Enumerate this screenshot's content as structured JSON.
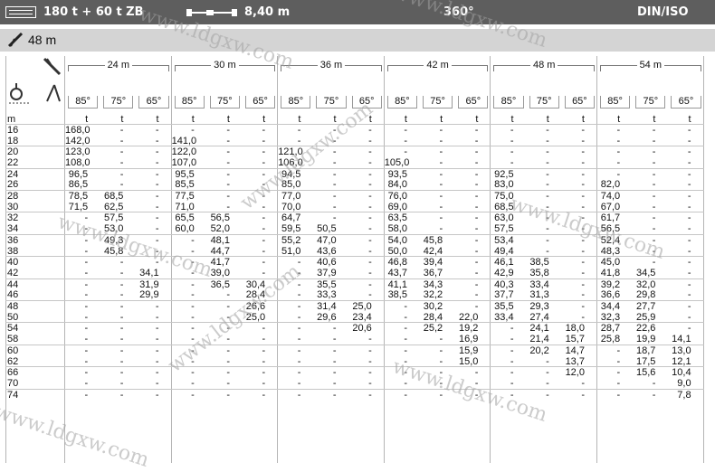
{
  "header": {
    "config": "180 t + 60 t ZB",
    "boom_length": "8,40 m",
    "slew": "360°",
    "standard": "DIN/ISO"
  },
  "subheader": {
    "jib_length": "48 m"
  },
  "table": {
    "luffing_lengths": [
      "24 m",
      "30 m",
      "36 m",
      "42 m",
      "48 m",
      "54 m"
    ],
    "angles": [
      "85°",
      "75°",
      "65°",
      "85°",
      "75°",
      "65°",
      "85°",
      "75°",
      "65°",
      "85°",
      "75°",
      "65°",
      "85°",
      "75°",
      "65°",
      "85°",
      "75°",
      "65°"
    ],
    "unit_row": [
      "m",
      "t",
      "t",
      "t",
      "t",
      "t",
      "t",
      "t",
      "t",
      "t",
      "t",
      "t",
      "t",
      "t",
      "t",
      "t",
      "t",
      "t",
      "t"
    ],
    "rows": [
      [
        "16",
        "168,0",
        "-",
        "-",
        "-",
        "-",
        "-",
        "-",
        "-",
        "-",
        "-",
        "-",
        "-",
        "-",
        "-",
        "-",
        "-",
        "-",
        "-"
      ],
      [
        "18",
        "142,0",
        "-",
        "-",
        "141,0",
        "-",
        "-",
        "-",
        "-",
        "-",
        "-",
        "-",
        "-",
        "-",
        "-",
        "-",
        "-",
        "-",
        "-"
      ],
      [
        "20",
        "123,0",
        "-",
        "-",
        "122,0",
        "-",
        "-",
        "121,0",
        "-",
        "-",
        "-",
        "-",
        "-",
        "-",
        "-",
        "-",
        "-",
        "-",
        "-"
      ],
      [
        "22",
        "108,0",
        "-",
        "-",
        "107,0",
        "-",
        "-",
        "106,0",
        "-",
        "-",
        "105,0",
        "-",
        "-",
        "-",
        "-",
        "-",
        "-",
        "-",
        "-"
      ],
      [
        "24",
        "96,5",
        "-",
        "-",
        "95,5",
        "-",
        "-",
        "94,5",
        "-",
        "-",
        "93,5",
        "-",
        "-",
        "92,5",
        "-",
        "-",
        "-",
        "-",
        "-"
      ],
      [
        "26",
        "86,5",
        "-",
        "-",
        "85,5",
        "-",
        "-",
        "85,0",
        "-",
        "-",
        "84,0",
        "-",
        "-",
        "83,0",
        "-",
        "-",
        "82,0",
        "-",
        "-"
      ],
      [
        "28",
        "78,5",
        "68,5",
        "-",
        "77,5",
        "-",
        "-",
        "77,0",
        "-",
        "-",
        "76,0",
        "-",
        "-",
        "75,0",
        "-",
        "-",
        "74,0",
        "-",
        "-"
      ],
      [
        "30",
        "71,5",
        "62,5",
        "-",
        "71,0",
        "-",
        "-",
        "70,0",
        "-",
        "-",
        "69,0",
        "-",
        "-",
        "68,5",
        "-",
        "-",
        "67,0",
        "-",
        "-"
      ],
      [
        "32",
        "-",
        "57,5",
        "-",
        "65,5",
        "56,5",
        "-",
        "64,7",
        "-",
        "-",
        "63,5",
        "-",
        "-",
        "63,0",
        "-",
        "-",
        "61,7",
        "-",
        "-"
      ],
      [
        "34",
        "-",
        "53,0",
        "-",
        "60,0",
        "52,0",
        "-",
        "59,5",
        "50,5",
        "-",
        "58,0",
        "-",
        "-",
        "57,5",
        "-",
        "-",
        "56,5",
        "-",
        "-"
      ],
      [
        "36",
        "-",
        "49,3",
        "-",
        "-",
        "48,1",
        "-",
        "55,2",
        "47,0",
        "-",
        "54,0",
        "45,8",
        "-",
        "53,4",
        "-",
        "-",
        "52,4",
        "-",
        "-"
      ],
      [
        "38",
        "-",
        "45,8",
        "-",
        "-",
        "44,7",
        "-",
        "51,0",
        "43,6",
        "-",
        "50,0",
        "42,4",
        "-",
        "49,4",
        "-",
        "-",
        "48,3",
        "-",
        "-"
      ],
      [
        "40",
        "-",
        "-",
        "-",
        "-",
        "41,7",
        "-",
        "-",
        "40,6",
        "-",
        "46,8",
        "39,4",
        "-",
        "46,1",
        "38,5",
        "-",
        "45,0",
        "-",
        "-"
      ],
      [
        "42",
        "-",
        "-",
        "34,1",
        "-",
        "39,0",
        "-",
        "-",
        "37,9",
        "-",
        "43,7",
        "36,7",
        "-",
        "42,9",
        "35,8",
        "-",
        "41,8",
        "34,5",
        "-"
      ],
      [
        "44",
        "-",
        "-",
        "31,9",
        "-",
        "36,5",
        "30,4",
        "-",
        "35,5",
        "-",
        "41,1",
        "34,3",
        "-",
        "40,3",
        "33,4",
        "-",
        "39,2",
        "32,0",
        "-"
      ],
      [
        "46",
        "-",
        "-",
        "29,9",
        "-",
        "-",
        "28,4",
        "-",
        "33,3",
        "-",
        "38,5",
        "32,2",
        "-",
        "37,7",
        "31,3",
        "-",
        "36,6",
        "29,8",
        "-"
      ],
      [
        "48",
        "-",
        "-",
        "-",
        "-",
        "-",
        "26,6",
        "-",
        "31,4",
        "25,0",
        "-",
        "30,2",
        "-",
        "35,5",
        "29,3",
        "-",
        "34,4",
        "27,7",
        "-"
      ],
      [
        "50",
        "-",
        "-",
        "-",
        "-",
        "-",
        "25,0",
        "-",
        "29,6",
        "23,4",
        "-",
        "28,4",
        "22,0",
        "33,4",
        "27,4",
        "-",
        "32,3",
        "25,9",
        "-"
      ],
      [
        "54",
        "-",
        "-",
        "-",
        "-",
        "-",
        "-",
        "-",
        "-",
        "20,6",
        "-",
        "25,2",
        "19,2",
        "-",
        "24,1",
        "18,0",
        "28,7",
        "22,6",
        "-"
      ],
      [
        "58",
        "-",
        "-",
        "-",
        "-",
        "-",
        "-",
        "-",
        "-",
        "-",
        "-",
        "-",
        "16,9",
        "-",
        "21,4",
        "15,7",
        "25,8",
        "19,9",
        "14,1"
      ],
      [
        "60",
        "-",
        "-",
        "-",
        "-",
        "-",
        "-",
        "-",
        "-",
        "-",
        "-",
        "-",
        "15,9",
        "-",
        "20,2",
        "14,7",
        "-",
        "18,7",
        "13,0"
      ],
      [
        "62",
        "-",
        "-",
        "-",
        "-",
        "-",
        "-",
        "-",
        "-",
        "-",
        "-",
        "-",
        "15,0",
        "-",
        "-",
        "13,7",
        "-",
        "17,5",
        "12,1"
      ],
      [
        "66",
        "-",
        "-",
        "-",
        "-",
        "-",
        "-",
        "-",
        "-",
        "-",
        "-",
        "-",
        "-",
        "-",
        "-",
        "12,0",
        "-",
        "15,6",
        "10,4"
      ],
      [
        "70",
        "-",
        "-",
        "-",
        "-",
        "-",
        "-",
        "-",
        "-",
        "-",
        "-",
        "-",
        "-",
        "-",
        "-",
        "-",
        "-",
        "-",
        "9,0"
      ],
      [
        "74",
        "-",
        "-",
        "-",
        "-",
        "-",
        "-",
        "-",
        "-",
        "-",
        "-",
        "-",
        "-",
        "-",
        "-",
        "-",
        "-",
        "-",
        "7,8"
      ]
    ]
  },
  "watermark": "www.ldgxw.com",
  "icons": [
    "menu-icon",
    "boom-length-icon",
    "jib-icon",
    "luffing-jib-icon",
    "hook-radius-icon",
    "luffing-angle-icon"
  ]
}
